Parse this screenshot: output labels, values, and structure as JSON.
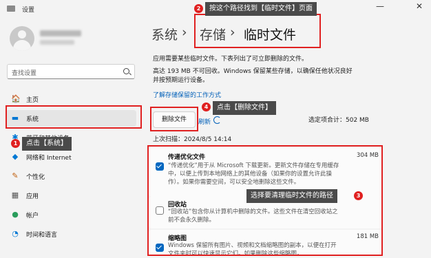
{
  "window": {
    "title": "设置",
    "minimize_glyph": "—",
    "close_glyph": "✕"
  },
  "user": {
    "avatar_icon": "user-icon"
  },
  "search": {
    "placeholder": "查找设置"
  },
  "sidebar": {
    "items": [
      {
        "label": "主页",
        "icon": "🏠",
        "icon_name": "home-icon"
      },
      {
        "label": "系统",
        "icon": "▬",
        "icon_name": "monitor-icon",
        "active": true
      },
      {
        "label": "蓝牙和其他设备",
        "icon": "✱",
        "icon_name": "bluetooth-icon"
      },
      {
        "label": "网络和 Internet",
        "icon": "◆",
        "icon_name": "wifi-icon"
      },
      {
        "label": "个性化",
        "icon": "✎",
        "icon_name": "brush-icon"
      },
      {
        "label": "应用",
        "icon": "▦",
        "icon_name": "apps-icon"
      },
      {
        "label": "帐户",
        "icon": "●",
        "icon_name": "account-icon"
      },
      {
        "label": "时间和语言",
        "icon": "◔",
        "icon_name": "clock-icon"
      }
    ]
  },
  "breadcrumb": {
    "part1": "系统",
    "sep": "›",
    "part2": "存储",
    "part3": "临时文件"
  },
  "main": {
    "intro": "应用需要某些临时文件。下表列出了可立即删除的文件。",
    "high_line1": "高达 193 MB 不可回收。Windows 保留某些存储，以确保任他状况良好",
    "high_line2": "并按预期运行设备。",
    "learn_link": "了解存储保留的工作方式",
    "delete_button": "删除文件",
    "refresh_link": "刷新",
    "selected_total": "选定项合计：502 MB",
    "last_scan": "上次扫描：2024/8/5 14:14"
  },
  "items": [
    {
      "title": "传递优化文件",
      "size": "304 MB",
      "checked": true,
      "desc1": "“传递优化”用于从 Microsoft 下载更新。更新文件存储在专用缓存",
      "desc2": "中，以便上传到本地网络上的其他设备（如果你的设置允许此操",
      "desc3": "作）。如果你需要空间，可以安全地删除这些文件。"
    },
    {
      "title": "回收站",
      "size": "",
      "checked": false,
      "desc1": "“回收站”包含你从计算机中删除的文件。这些文件在清空回收站之",
      "desc2": "前不会永久删除。"
    },
    {
      "title": "缩略图",
      "size": "181 MB",
      "checked": true,
      "desc1": "Windows 保留所有图片、视频和文档缩略图的副本，以便在打开",
      "desc2": "文件夹时可以快速显示它们。如果删除这些缩略图，"
    }
  ],
  "annotations": {
    "a1": {
      "num": "1",
      "text": "点击【系统】"
    },
    "a2": {
      "num": "2",
      "text": "按这个路径找到【临时文件】页面"
    },
    "a3": {
      "num": "3",
      "text": "选择要清理临时文件的路径"
    },
    "a4": {
      "num": "4",
      "text": "点击【删除文件】"
    }
  },
  "colors": {
    "accent": "#0067c0",
    "annotation_red": "#e02020",
    "callout_bg": "#4a4a4a"
  }
}
